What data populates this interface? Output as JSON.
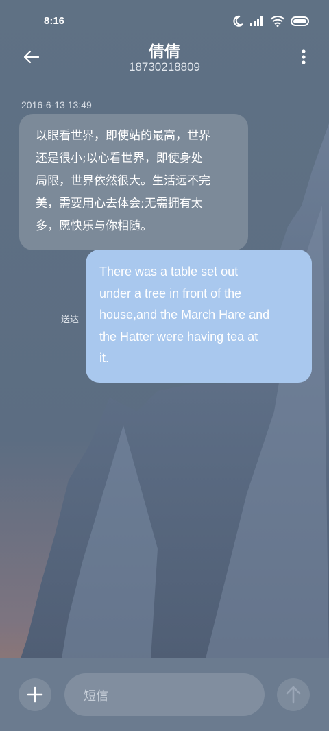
{
  "status_bar": {
    "time": "8:16",
    "icons": [
      "moon-icon",
      "signal-icon",
      "wifi-icon",
      "battery-icon"
    ]
  },
  "header": {
    "contact_name": "倩倩",
    "contact_number": "18730218809",
    "back_icon": "back-arrow-icon",
    "more_icon": "more-vertical-icon"
  },
  "conversation": {
    "timestamp": "2016-6-13 13:49",
    "incoming": {
      "lines": [
        "以眼看世界，即使站的最高，世界",
        "还是很小;以心看世界，即使身处",
        "局限，世界依然很大。生活远不完",
        "美，需要用心去体会;无需拥有太",
        "多，愿快乐与你相随。"
      ]
    },
    "outgoing": {
      "status": "送达",
      "lines": [
        "There was a table set out",
        "under a tree in front of the",
        "house,and the March Hare and",
        "the Hatter were having tea at",
        "it."
      ]
    }
  },
  "composer": {
    "placeholder": "短信",
    "add_icon": "plus-icon",
    "send_icon": "send-arrow-icon"
  },
  "colors": {
    "outgoing_bubble": "#a9c8ee",
    "composer_bg": "#6b7b8f"
  }
}
